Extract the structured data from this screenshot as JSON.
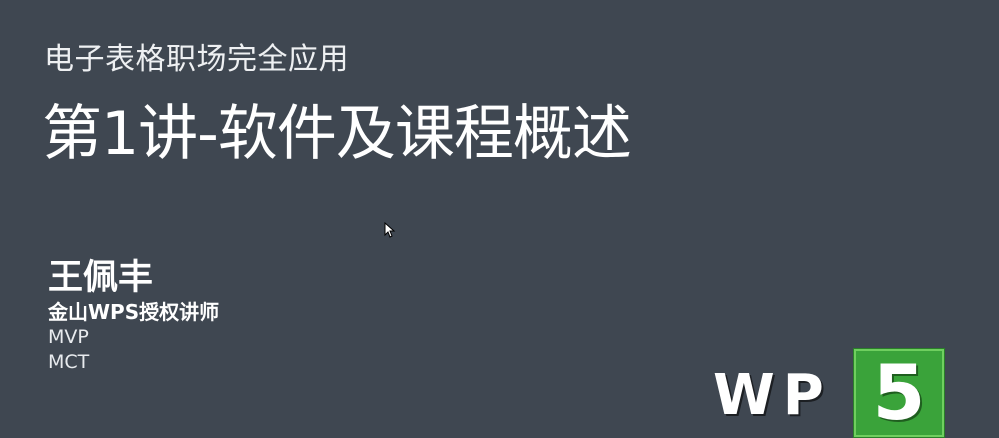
{
  "slide": {
    "subtitle": "电子表格职场完全应用",
    "title": "第1讲-软件及课程概述"
  },
  "author": {
    "name": "王佩丰",
    "role": "金山WPS授权讲师",
    "lines": [
      "MVP",
      "MCT"
    ]
  },
  "logo": {
    "text": "WP",
    "box_text": "5",
    "colors": {
      "box": "#3aa33a",
      "text": "#ffffff"
    }
  },
  "colors": {
    "background": "#3f4751",
    "accent": "#3aa33a"
  },
  "cursor": {
    "icon": "mouse-pointer-icon"
  }
}
